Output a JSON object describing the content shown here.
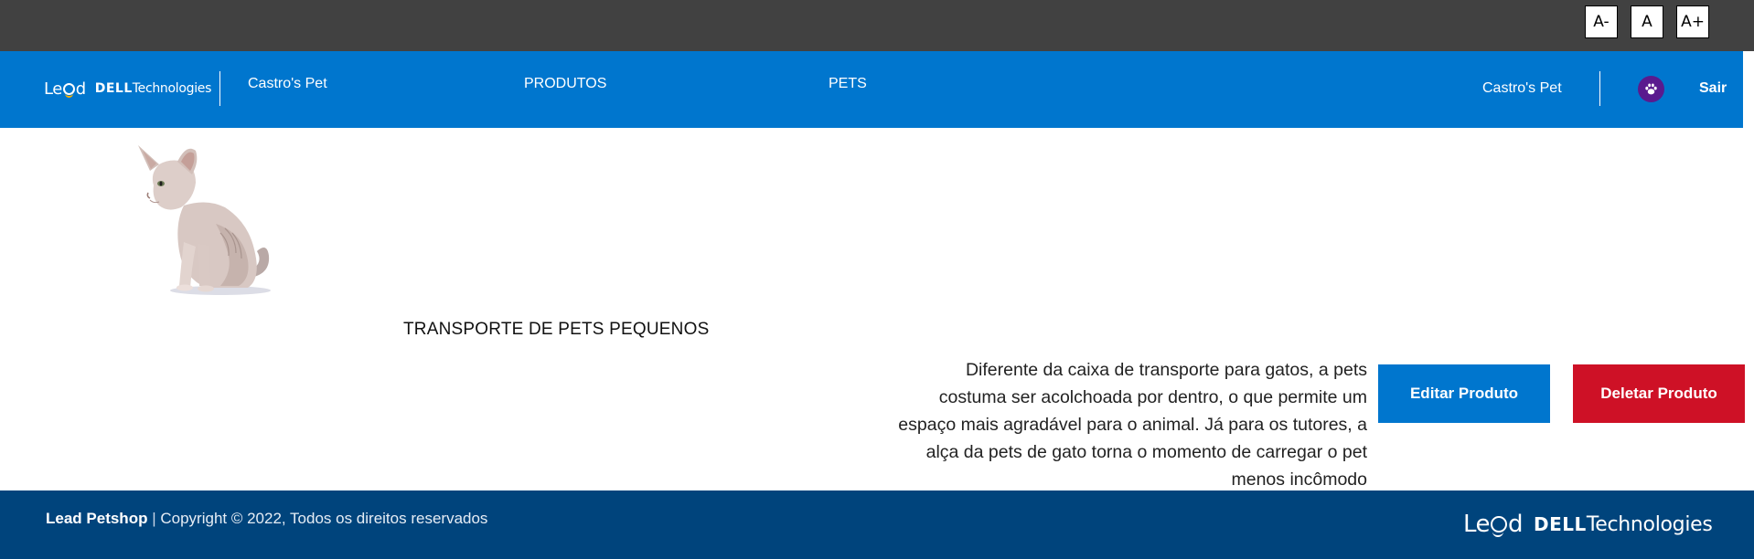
{
  "accessibility": {
    "decrease_label": "A-",
    "reset_label": "A",
    "increase_label": "A+"
  },
  "header": {
    "logo": {
      "lead": "Lead",
      "dell": "DELL",
      "tech": "Technologies"
    },
    "nav": {
      "brand": "Castro's Pet",
      "produtos": "PRODUTOS",
      "pets": "PETS"
    },
    "user_name": "Castro's Pet",
    "logout_label": "Sair",
    "avatar_icon": "paw-icon",
    "avatar_color": "#5a1a8e"
  },
  "product": {
    "image_icon": "hairless-cat-photo",
    "title": "TRANSPORTE DE PETS PEQUENOS",
    "description": "Diferente da caixa de transporte para gatos, a pets costuma ser acolchoada por dentro, o que permite um espaço mais agradável para o animal. Já para os tutores, a alça da pets de gato torna o momento de carregar o pet menos incômodo",
    "edit_label": "Editar Produto",
    "delete_label": "Deletar Produto"
  },
  "footer": {
    "brand": "Lead Petshop",
    "separator": "|",
    "copyright": "Copyright © 2022, Todos os direitos reservados",
    "logo": {
      "lead": "Lead",
      "dell": "DELL",
      "tech": "Technologies"
    }
  },
  "colors": {
    "accessibility_bar": "#414141",
    "header": "#0076ce",
    "edit_button": "#0076ce",
    "delete_button": "#ce1126",
    "footer": "#00447c"
  }
}
